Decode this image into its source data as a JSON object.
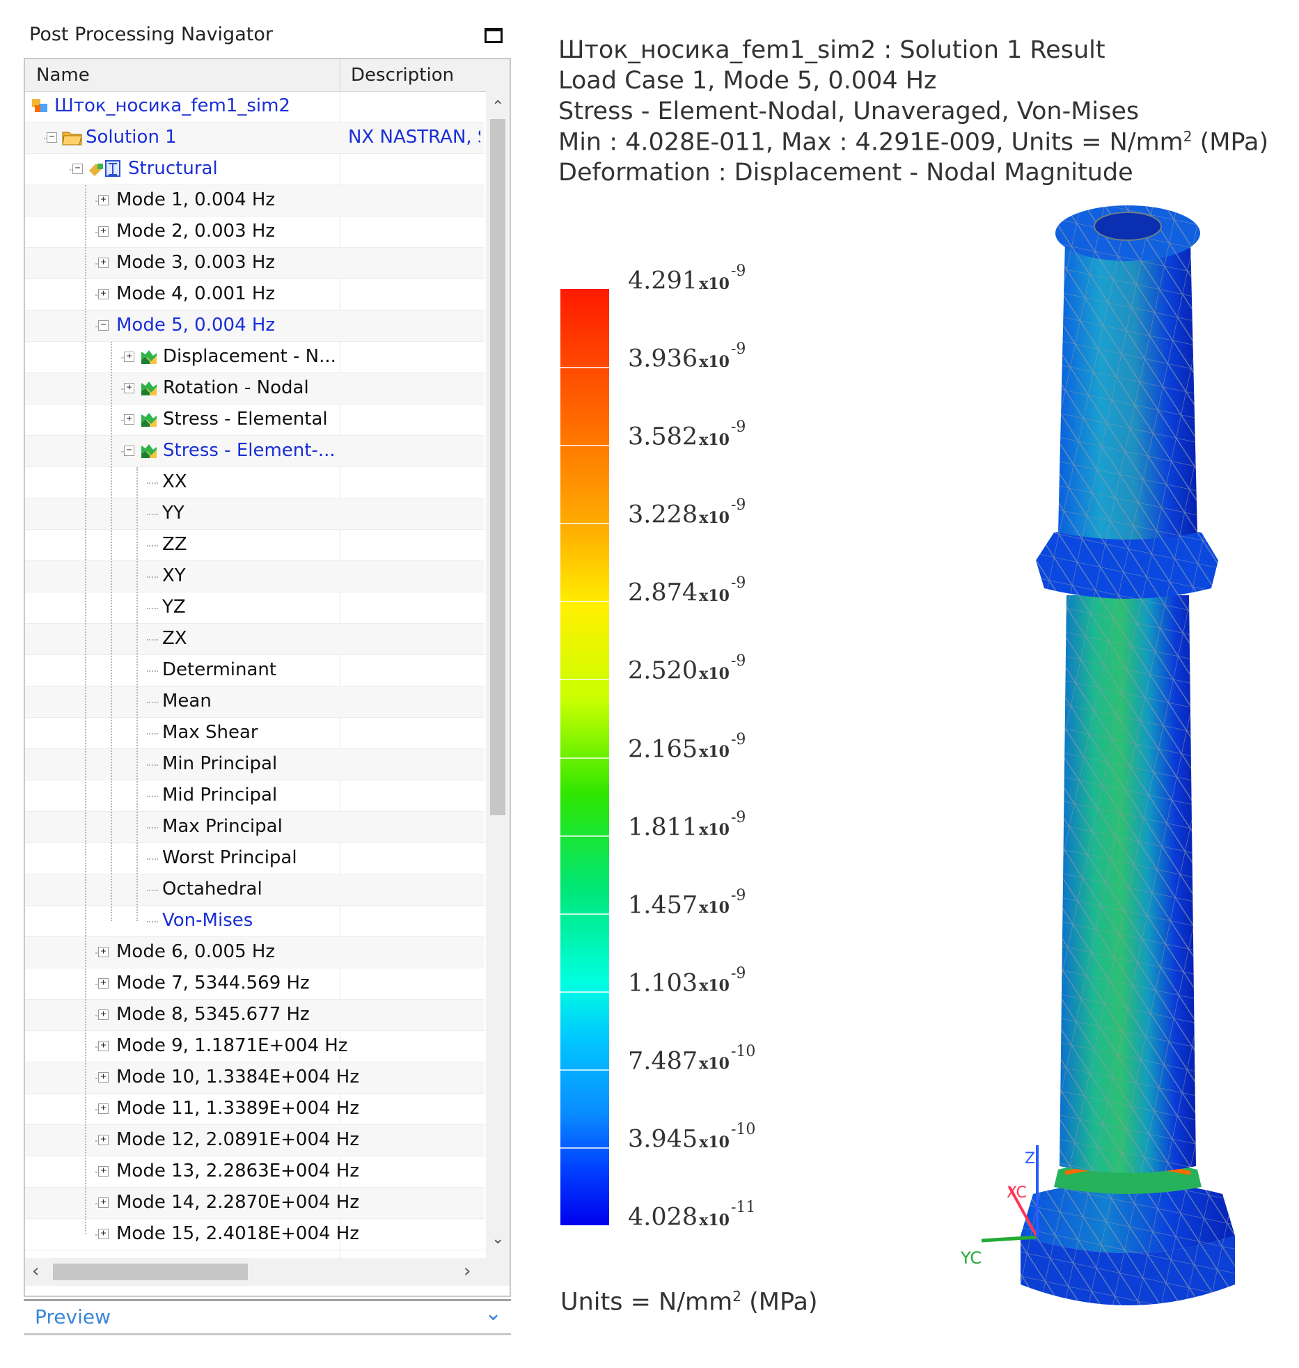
{
  "navigator": {
    "title": "Post Processing Navigator",
    "columns": {
      "name": "Name",
      "description": "Description"
    },
    "rows": [
      {
        "label": "Шток_носика_fem1_sim2",
        "indent": 0,
        "exp": "",
        "icon": "sim",
        "selected": true,
        "desc": ""
      },
      {
        "label": "Solution 1",
        "indent": 1,
        "exp": "-",
        "icon": "folder",
        "selected": true,
        "desc": "NX NASTRAN, St"
      },
      {
        "label": "Structural",
        "indent": 2,
        "exp": "-",
        "icon": "structural",
        "selected": true,
        "desc": ""
      },
      {
        "label": "Mode 1, 0.004 Hz",
        "indent": 3,
        "exp": "+",
        "icon": "",
        "selected": false,
        "desc": ""
      },
      {
        "label": "Mode 2, 0.003 Hz",
        "indent": 3,
        "exp": "+",
        "icon": "",
        "selected": false,
        "desc": ""
      },
      {
        "label": "Mode 3, 0.003 Hz",
        "indent": 3,
        "exp": "+",
        "icon": "",
        "selected": false,
        "desc": ""
      },
      {
        "label": "Mode 4, 0.001 Hz",
        "indent": 3,
        "exp": "+",
        "icon": "",
        "selected": false,
        "desc": ""
      },
      {
        "label": "Mode 5, 0.004 Hz",
        "indent": 3,
        "exp": "-",
        "icon": "",
        "selected": true,
        "desc": ""
      },
      {
        "label": "Displacement - N...",
        "indent": 4,
        "exp": "+",
        "icon": "result",
        "selected": false,
        "desc": ""
      },
      {
        "label": "Rotation - Nodal",
        "indent": 4,
        "exp": "+",
        "icon": "result",
        "selected": false,
        "desc": ""
      },
      {
        "label": "Stress - Elemental",
        "indent": 4,
        "exp": "+",
        "icon": "result",
        "selected": false,
        "desc": ""
      },
      {
        "label": "Stress - Element-...",
        "indent": 4,
        "exp": "-",
        "icon": "result",
        "selected": true,
        "desc": ""
      },
      {
        "label": "XX",
        "indent": 5,
        "exp": "",
        "icon": "",
        "selected": false,
        "desc": ""
      },
      {
        "label": "YY",
        "indent": 5,
        "exp": "",
        "icon": "",
        "selected": false,
        "desc": ""
      },
      {
        "label": "ZZ",
        "indent": 5,
        "exp": "",
        "icon": "",
        "selected": false,
        "desc": ""
      },
      {
        "label": "XY",
        "indent": 5,
        "exp": "",
        "icon": "",
        "selected": false,
        "desc": ""
      },
      {
        "label": "YZ",
        "indent": 5,
        "exp": "",
        "icon": "",
        "selected": false,
        "desc": ""
      },
      {
        "label": "ZX",
        "indent": 5,
        "exp": "",
        "icon": "",
        "selected": false,
        "desc": ""
      },
      {
        "label": "Determinant",
        "indent": 5,
        "exp": "",
        "icon": "",
        "selected": false,
        "desc": ""
      },
      {
        "label": "Mean",
        "indent": 5,
        "exp": "",
        "icon": "",
        "selected": false,
        "desc": ""
      },
      {
        "label": "Max Shear",
        "indent": 5,
        "exp": "",
        "icon": "",
        "selected": false,
        "desc": ""
      },
      {
        "label": "Min Principal",
        "indent": 5,
        "exp": "",
        "icon": "",
        "selected": false,
        "desc": ""
      },
      {
        "label": "Mid Principal",
        "indent": 5,
        "exp": "",
        "icon": "",
        "selected": false,
        "desc": ""
      },
      {
        "label": "Max Principal",
        "indent": 5,
        "exp": "",
        "icon": "",
        "selected": false,
        "desc": ""
      },
      {
        "label": "Worst Principal",
        "indent": 5,
        "exp": "",
        "icon": "",
        "selected": false,
        "desc": ""
      },
      {
        "label": "Octahedral",
        "indent": 5,
        "exp": "",
        "icon": "",
        "selected": false,
        "desc": ""
      },
      {
        "label": "Von-Mises",
        "indent": 5,
        "exp": "",
        "icon": "",
        "selected": true,
        "desc": ""
      },
      {
        "label": "Mode 6, 0.005 Hz",
        "indent": 3,
        "exp": "+",
        "icon": "",
        "selected": false,
        "desc": ""
      },
      {
        "label": "Mode 7, 5344.569 Hz",
        "indent": 3,
        "exp": "+",
        "icon": "",
        "selected": false,
        "desc": ""
      },
      {
        "label": "Mode 8, 5345.677 Hz",
        "indent": 3,
        "exp": "+",
        "icon": "",
        "selected": false,
        "desc": ""
      },
      {
        "label": "Mode 9, 1.1871E+004 Hz",
        "indent": 3,
        "exp": "+",
        "icon": "",
        "selected": false,
        "desc": ""
      },
      {
        "label": "Mode 10, 1.3384E+004 Hz",
        "indent": 3,
        "exp": "+",
        "icon": "",
        "selected": false,
        "desc": ""
      },
      {
        "label": "Mode 11, 1.3389E+004 Hz",
        "indent": 3,
        "exp": "+",
        "icon": "",
        "selected": false,
        "desc": ""
      },
      {
        "label": "Mode 12, 2.0891E+004 Hz",
        "indent": 3,
        "exp": "+",
        "icon": "",
        "selected": false,
        "desc": ""
      },
      {
        "label": "Mode 13, 2.2863E+004 Hz",
        "indent": 3,
        "exp": "+",
        "icon": "",
        "selected": false,
        "desc": ""
      },
      {
        "label": "Mode 14, 2.2870E+004 Hz",
        "indent": 3,
        "exp": "+",
        "icon": "",
        "selected": false,
        "desc": ""
      },
      {
        "label": "Mode 15, 2.4018E+004 Hz",
        "indent": 3,
        "exp": "+",
        "icon": "",
        "selected": false,
        "desc": ""
      }
    ],
    "preview_label": "Preview"
  },
  "result": {
    "line1": "Шток_носика_fem1_sim2 : Solution 1 Result",
    "line2": "Load Case 1, Mode 5, 0.004 Hz",
    "line3": "Stress - Element-Nodal, Unaveraged, Von-Mises",
    "line4_pre": "Min : 4.028E-011, Max : 4.291E-009, Units = N/mm",
    "line4_sup": "2",
    "line4_post": " (MPa)",
    "line5": "Deformation : Displacement - Nodal Magnitude"
  },
  "legend": {
    "ticks": [
      {
        "mant": "4.291",
        "times": "x10",
        "exp": "-9"
      },
      {
        "mant": "3.936",
        "times": "x10",
        "exp": "-9"
      },
      {
        "mant": "3.582",
        "times": "x10",
        "exp": "-9"
      },
      {
        "mant": "3.228",
        "times": "x10",
        "exp": "-9"
      },
      {
        "mant": "2.874",
        "times": "x10",
        "exp": "-9"
      },
      {
        "mant": "2.520",
        "times": "x10",
        "exp": "-9"
      },
      {
        "mant": "2.165",
        "times": "x10",
        "exp": "-9"
      },
      {
        "mant": "1.811",
        "times": "x10",
        "exp": "-9"
      },
      {
        "mant": "1.457",
        "times": "x10",
        "exp": "-9"
      },
      {
        "mant": "1.103",
        "times": "x10",
        "exp": "-9"
      },
      {
        "mant": "7.487",
        "times": "x10",
        "exp": "-10"
      },
      {
        "mant": "3.945",
        "times": "x10",
        "exp": "-10"
      },
      {
        "mant": "4.028",
        "times": "x10",
        "exp": "-11"
      }
    ],
    "units_pre": "Units = N/mm",
    "units_sup": "2",
    "units_post": " (MPa)"
  },
  "triad": {
    "z": "Z",
    "x": "XC",
    "y": "YC"
  },
  "colors": {
    "selected_text": "#1a2ed6",
    "preview_text": "#3a87d6"
  }
}
